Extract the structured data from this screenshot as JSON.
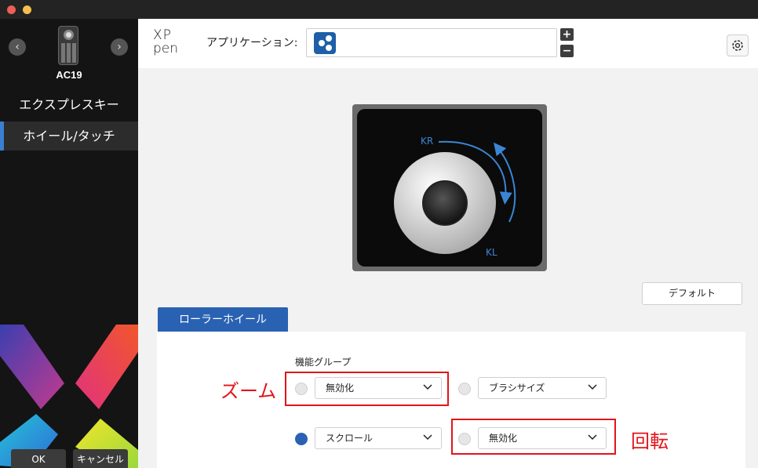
{
  "sidebar": {
    "device_name": "AC19",
    "prev_symbol": "‹",
    "next_symbol": "›",
    "items": [
      {
        "label": "エクスプレスキー"
      },
      {
        "label": "ホイール/タッチ"
      }
    ],
    "ok_label": "OK",
    "cancel_label": "キャンセル"
  },
  "header": {
    "brand_line1": "XP",
    "brand_line2": "pen",
    "app_label": "アプリケーション:",
    "plus": "+",
    "minus": "−"
  },
  "device_view": {
    "kr_label": "KR",
    "kl_label": "KL"
  },
  "default_button": "デフォルト",
  "tab_label": "ローラーホイール",
  "function_group": {
    "label": "機能グループ",
    "options": [
      {
        "value": "無効化",
        "selected": false
      },
      {
        "value": "ブラシサイズ",
        "selected": false
      },
      {
        "value": "スクロール",
        "selected": true
      },
      {
        "value": "無効化",
        "selected": false
      }
    ]
  },
  "annotations": {
    "zoom": "ズーム",
    "rotate": "回転"
  },
  "colors": {
    "accent": "#2a62b3",
    "annotation": "#e3141b",
    "sidebar_bg": "#141414"
  },
  "icons": [
    "device-icon",
    "app-icon",
    "gear-icon",
    "chevron-down-icon"
  ]
}
